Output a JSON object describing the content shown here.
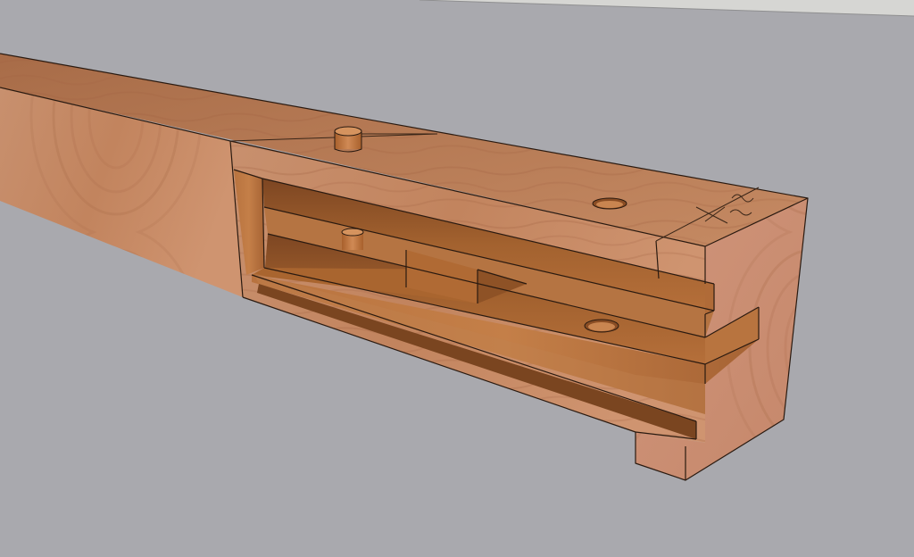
{
  "viewport": {
    "background_color": "#a9a9ae",
    "horizon_color": "#d6d6d3",
    "edge_color": "#2a1a10"
  },
  "model": {
    "type": "timber-joint-3d",
    "material": "wood",
    "top_face_color": "#b97a55",
    "side_face_color": "#c38763",
    "end_face_color": "#c88b67",
    "cavity_color": "#9c5a2c",
    "cavity_shadow_color": "#7a4520",
    "peg_color": "#c27a48",
    "visible_features": [
      "beam",
      "housing",
      "mortise-slots",
      "pegs",
      "peg-holes",
      "layout-marks"
    ]
  }
}
